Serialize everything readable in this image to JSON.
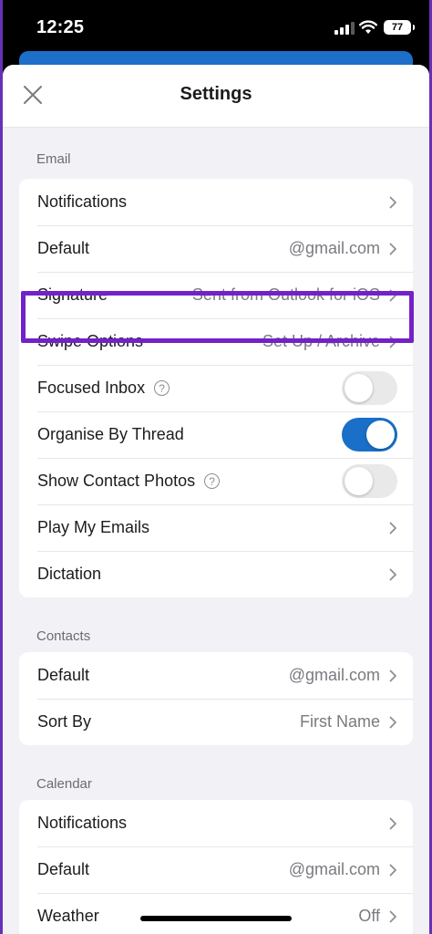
{
  "status": {
    "time": "12:25",
    "battery": "77"
  },
  "header": {
    "title": "Settings"
  },
  "sections": {
    "email": {
      "label": "Email",
      "notifications": "Notifications",
      "default_label": "Default",
      "default_value": "@gmail.com",
      "signature_label": "Signature",
      "signature_value": "Sent from Outlook for iOS",
      "swipe_label": "Swipe Options",
      "swipe_value": "Set Up / Archive",
      "focused_inbox": {
        "label": "Focused Inbox",
        "enabled": false
      },
      "organise_by_thread": {
        "label": "Organise By Thread",
        "enabled": true
      },
      "show_contact_photos": {
        "label": "Show Contact Photos",
        "enabled": false
      },
      "play_my_emails": "Play My Emails",
      "dictation": "Dictation"
    },
    "contacts": {
      "label": "Contacts",
      "default_label": "Default",
      "default_value": "@gmail.com",
      "sort_label": "Sort By",
      "sort_value": "First Name"
    },
    "calendar": {
      "label": "Calendar",
      "notifications": "Notifications",
      "default_label": "Default",
      "default_value": "@gmail.com",
      "weather_label": "Weather",
      "weather_value": "Off"
    }
  },
  "help_glyph": "?",
  "colors": {
    "accent": "#1a6fc8",
    "highlight": "#7321c8",
    "backdrop": "#6a2fb8"
  }
}
